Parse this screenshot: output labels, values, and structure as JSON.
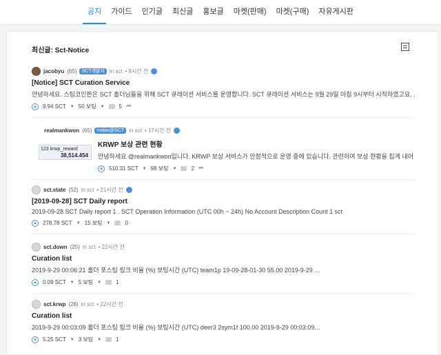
{
  "nav": [
    "공지",
    "가이드",
    "인기글",
    "최신글",
    "홍보글",
    "마켓(판매)",
    "마켓(구매)",
    "자유게시판"
  ],
  "panel_title": "최신글: Sct-Notice",
  "posts": [
    {
      "author": "jacobyu",
      "rep": "(65)",
      "badge": "SCT개발자",
      "community": "in sct",
      "time": "• 9시간 전",
      "title": "[Notice] SCT Curation Service",
      "body": "안녕하세요. 스팀코인판은 SCT 홀더님들을 위해 SCT 큐레이션 서비스를 운영합니다. SCT 큐레이션 서비스는 9월 29일 아침 9시부터 시작하였고요. …",
      "payout": "9.94 SCT",
      "votes": "50 보팅",
      "comments": "5"
    },
    {
      "author": "realmankwon",
      "rep": "(65)",
      "badge": "midas@SCT",
      "community": "in sct",
      "time": "• 17시간 전",
      "title": "KRWP 보상 관련 현황",
      "body": "안녕하세요 @realmankwon입니다. KRWP 보상 서비스가 안정적으로 운영 중에 있습니다. 관련하여 보상 현황을 집계 내어 …",
      "payout": "510.31 SCT",
      "votes": "98 보팅",
      "comments": "2",
      "thumb_label": "krwp_reward",
      "thumb_value": "38,514.454",
      "thumb_num": "123"
    },
    {
      "author": "sct.state",
      "rep": "(52)",
      "community": "in sct",
      "time": "• 21시간 전",
      "title": "[2019-09-28] SCT Daily report",
      "body": "2019-09-28 SCT Daily report 1 . SCT Operation Information (UTC 00h ~ 24h) No Account Description Count 1 sct",
      "payout": "278.78 SCT",
      "votes": "15 보팅",
      "comments": "0"
    },
    {
      "author": "sct.down",
      "rep": "(25)",
      "community": "in sct",
      "time": "• 22시간 전",
      "title": "Curation list",
      "body": "2019-9-29 00:06:21 홀더 포스팅 링크 비율 (%) 보팅시간 (UTC) team1p 19-09-28-01-30 55.00 2019-9-29 …",
      "payout": "0.09 SCT",
      "votes": "5 보팅",
      "comments": "1"
    },
    {
      "author": "sct.krwp",
      "rep": "(26)",
      "community": "in sct",
      "time": "• 22시간 전",
      "title": "Curation list",
      "body": "2019-9-29 00:03:09 홀더 포스팅 링크 비율 (%) 보팅시간 (UTC) deer3 2sym1f 100.00 2019-9-29 00:03:09…",
      "payout": "5.25 SCT",
      "votes": "3 보팅",
      "comments": "1"
    }
  ]
}
